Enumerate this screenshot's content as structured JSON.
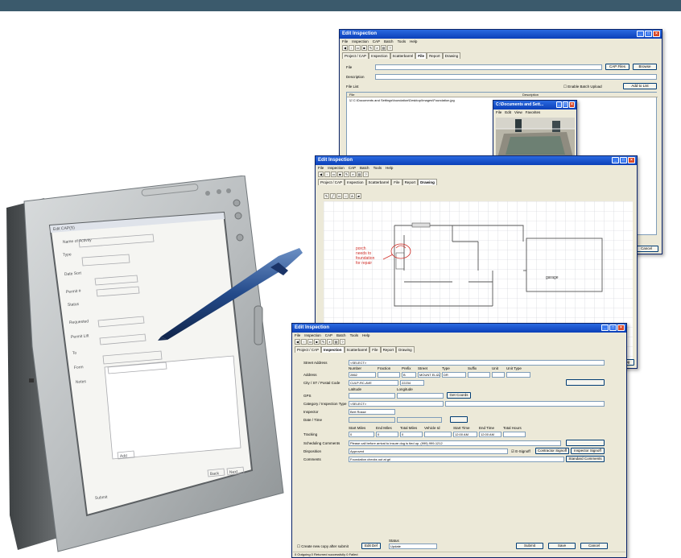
{
  "window_back": {
    "title": "Edit Inspection",
    "menu": [
      "File",
      "Inspection",
      "CAP",
      "Batch",
      "Tools",
      "Help"
    ],
    "tabs": [
      "Project / CAP",
      "Inspection",
      "Scatterbarrel",
      "File",
      "Report",
      "Drawing"
    ],
    "active_tab": "File",
    "file_label": "File",
    "description_label": "Description",
    "cap_files_button": "CAP Files",
    "browse_button": "Browse",
    "file_list_label": "File List",
    "enable_batch_label": "Enable Batch Upload",
    "add_to_list_button": "Add to List",
    "col_file": "File",
    "col_description": "Description",
    "file_row": "C:\\Documents and Settings\\foundation\\Desktop\\Images\\Foundation.jpg",
    "cancel_button": "Cancel"
  },
  "image_popup": {
    "title": "C:\\Documents and Sett...",
    "menu": [
      "File",
      "Edit",
      "View",
      "Favorites"
    ]
  },
  "window_mid": {
    "title": "Edit Inspection",
    "menu": [
      "File",
      "Inspection",
      "CAP",
      "Batch",
      "Tools",
      "Help"
    ],
    "tabs": [
      "Project / CAP",
      "Inspection",
      "Scatterbarrel",
      "File",
      "Report",
      "Drawing"
    ],
    "active_tab": "Drawing",
    "annotation_text": "porch\nneeds to\nfoundation\nfor repair",
    "room_label": "garage",
    "drawing_button": "Drawing",
    "cancel_button": "Cancel"
  },
  "window_front": {
    "title": "Edit Inspection",
    "menu": [
      "File",
      "Inspection",
      "CAP",
      "Batch",
      "Tools",
      "Help"
    ],
    "tabs": [
      "Project / CAP",
      "Inspection",
      "Scatterbarrel",
      "File",
      "Report",
      "Drawing"
    ],
    "active_tab": "Inspection",
    "labels": {
      "street_address": "Street Address",
      "address": "Address",
      "city": "City / ST / Postal Code",
      "gps": "GPS",
      "category": "Category / Inspection Type",
      "inspector": "Inspector",
      "date_time": "Date / Time",
      "tracking": "Tracking",
      "scheduling_comments": "Scheduling Comments",
      "disposition": "Disposition",
      "comments": "Comments"
    },
    "address_cols": [
      "Number",
      "Fraction",
      "Prefix",
      "Street",
      "Type",
      "Suffix",
      "Unit",
      "Unit Type"
    ],
    "address_values": [
      "2862",
      "",
      "B",
      "MOUNT ELIZA",
      "DR",
      "",
      "",
      ""
    ],
    "street_address_value": "<SELECT>",
    "city_value": "CULP-RC-AVE",
    "zip_value": "22234",
    "latitude_label": "Latitude",
    "longitude_label": "Longitude",
    "get_coords_button": "Get Coords",
    "category_value": "<SELECT>",
    "inspector_value": "Bert Rosse",
    "tracking_cols": [
      "Start Miles",
      "End Miles",
      "Total Miles",
      "Vehicle Id",
      "Start Time",
      "End Time",
      "Total Hours"
    ],
    "tracking_values": [
      "0",
      "0",
      "0",
      "",
      "12:00 AM",
      "12:00 AM",
      ""
    ],
    "scheduling_value": "Please call before arrival to insure dog is tied up. (999) 999-1212",
    "disposition_value": "Approved",
    "esignoff_label": "E-Signoff",
    "contractor_signoff_button": "Contractor Signoff",
    "inspector_signoff_button": "Inspector Signoff",
    "comments_value": "Foundation checks out at grl",
    "standard_comments_button": "Standard Comments",
    "create_new_label": "Create new copy after submit",
    "edit_defs_button": "Edit Def",
    "status_label": "Status",
    "status_value": "Update",
    "submit_button": "Submit",
    "save_button": "Save",
    "cancel_button": "Cancel",
    "statusbar": "0 Outgoing  0 Returned successfully  0 Failed"
  },
  "tablet_screen": {
    "title": "Edit CAP(S)",
    "rows": [
      "Name of Activity",
      "Type",
      "Date Sort",
      "Permit #",
      "Status",
      "Requested",
      "Permit Lift",
      "To",
      "Form",
      "Notes",
      "Submit"
    ],
    "buttons": [
      "Add",
      "Back",
      "Next"
    ]
  }
}
